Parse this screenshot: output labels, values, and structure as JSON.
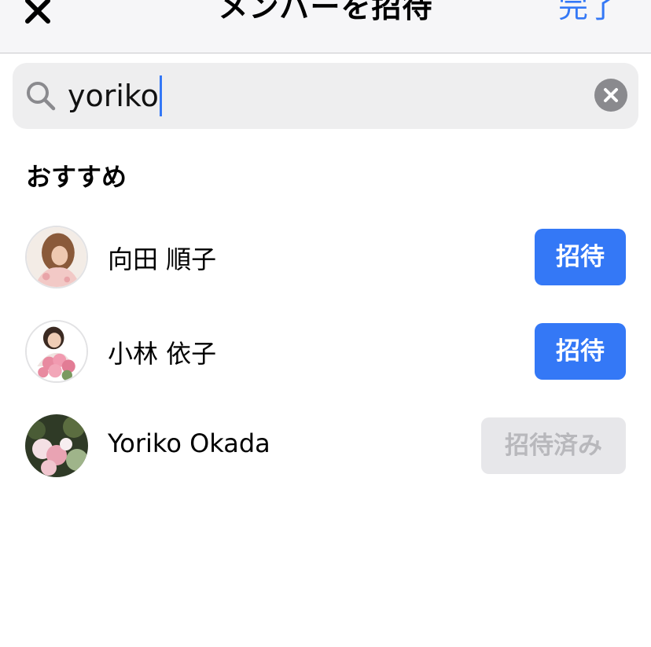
{
  "header": {
    "title": "メンバーを招待",
    "done_label": "完了",
    "close_icon": "close-icon"
  },
  "search": {
    "value": "yoriko",
    "icon": "search-icon",
    "clear_icon": "clear-icon"
  },
  "section": {
    "title": "おすすめ"
  },
  "members": [
    {
      "name": "向田 順子",
      "action_label": "招待",
      "state": "invite"
    },
    {
      "name": "小林 依子",
      "action_label": "招待",
      "state": "invite"
    },
    {
      "name": "Yoriko Okada",
      "action_label": "招待済み",
      "state": "invited"
    }
  ],
  "colors": {
    "accent": "#3478f6",
    "invited_bg": "#e7e7ea",
    "invited_text": "#b8b8bc"
  }
}
